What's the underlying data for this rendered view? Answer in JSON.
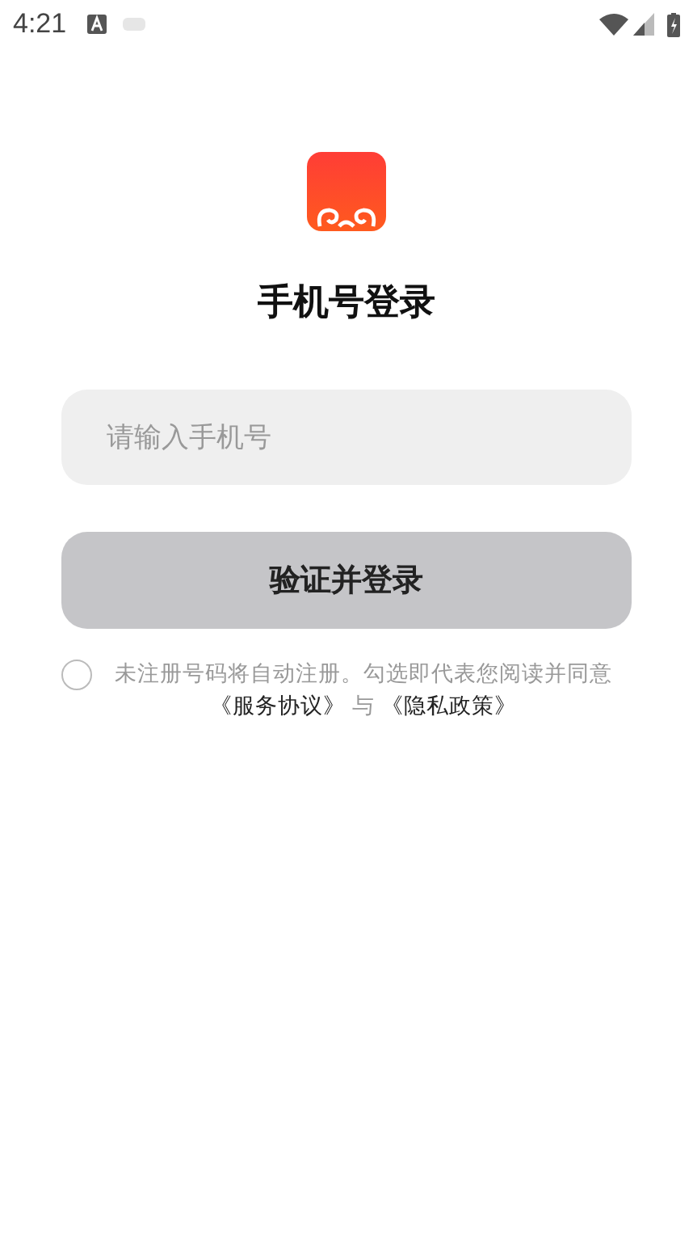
{
  "status_bar": {
    "time": "4:21"
  },
  "title": "手机号登录",
  "phone_field": {
    "placeholder": "请输入手机号"
  },
  "submit_button": {
    "label": "验证并登录",
    "disabled": true
  },
  "agreement": {
    "checked": false,
    "notice": "未注册号码将自动注册。勾选即代表您阅读并同意",
    "links": [
      "《服务协议》",
      "《隐私政策》"
    ],
    "conjunction": "与"
  }
}
